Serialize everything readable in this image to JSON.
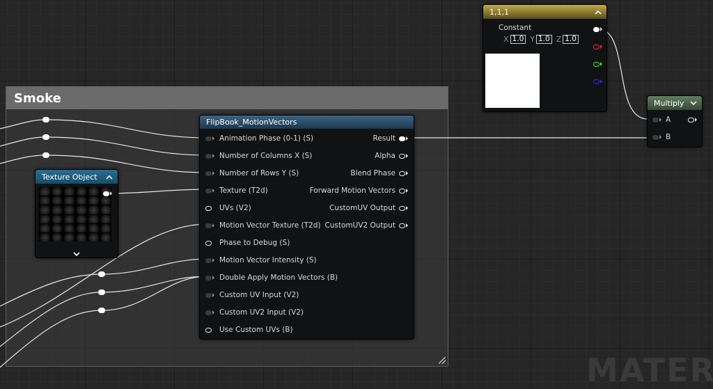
{
  "watermark": "MATERI",
  "comment": {
    "title": "Smoke"
  },
  "flipbook": {
    "title": "FlipBook_MotionVectors",
    "inputs": [
      "Animation  Phase (0-1) (S)",
      "Number of Columns X (S)",
      "Number of Rows Y (S)",
      "Texture (T2d)",
      "UVs (V2)",
      "Motion Vector Texture (T2d)",
      "Phase to Debug (S)",
      "Motion Vector Intensity (S)",
      "Double Apply Motion Vectors (B)",
      "Custom UV Input (V2)",
      "Custom UV2 Input (V2)",
      "Use Custom UVs (B)"
    ],
    "outputs": [
      "Result",
      "Alpha",
      "Blend Phase",
      "Forward Motion Vectors",
      "CustomUV Output",
      "CustomUV2 Output"
    ]
  },
  "texture_object": {
    "title": "Texture Object"
  },
  "constant": {
    "title": "1,1,1",
    "label": "Constant",
    "x_label": "X",
    "x": "1.0",
    "y_label": "Y",
    "y": "1.0",
    "z_label": "Z",
    "z": "1.0",
    "preview_color": "#ffffff",
    "channel_colors": [
      "#ff2a2a",
      "#2aff2a",
      "#2a2aff"
    ]
  },
  "multiply": {
    "title": "Multiply",
    "input_a": "A",
    "input_b": "B"
  },
  "colors": {
    "flipbook_header": "#2c4a63",
    "texture_header": "#1f5a7a",
    "constant_header": "#b09a3a",
    "multiply_header": "#4a6a4a"
  },
  "icons": {
    "collapse": "chevron-up-icon",
    "expand": "chevron-down-icon",
    "resize": "resize-grip-icon"
  }
}
